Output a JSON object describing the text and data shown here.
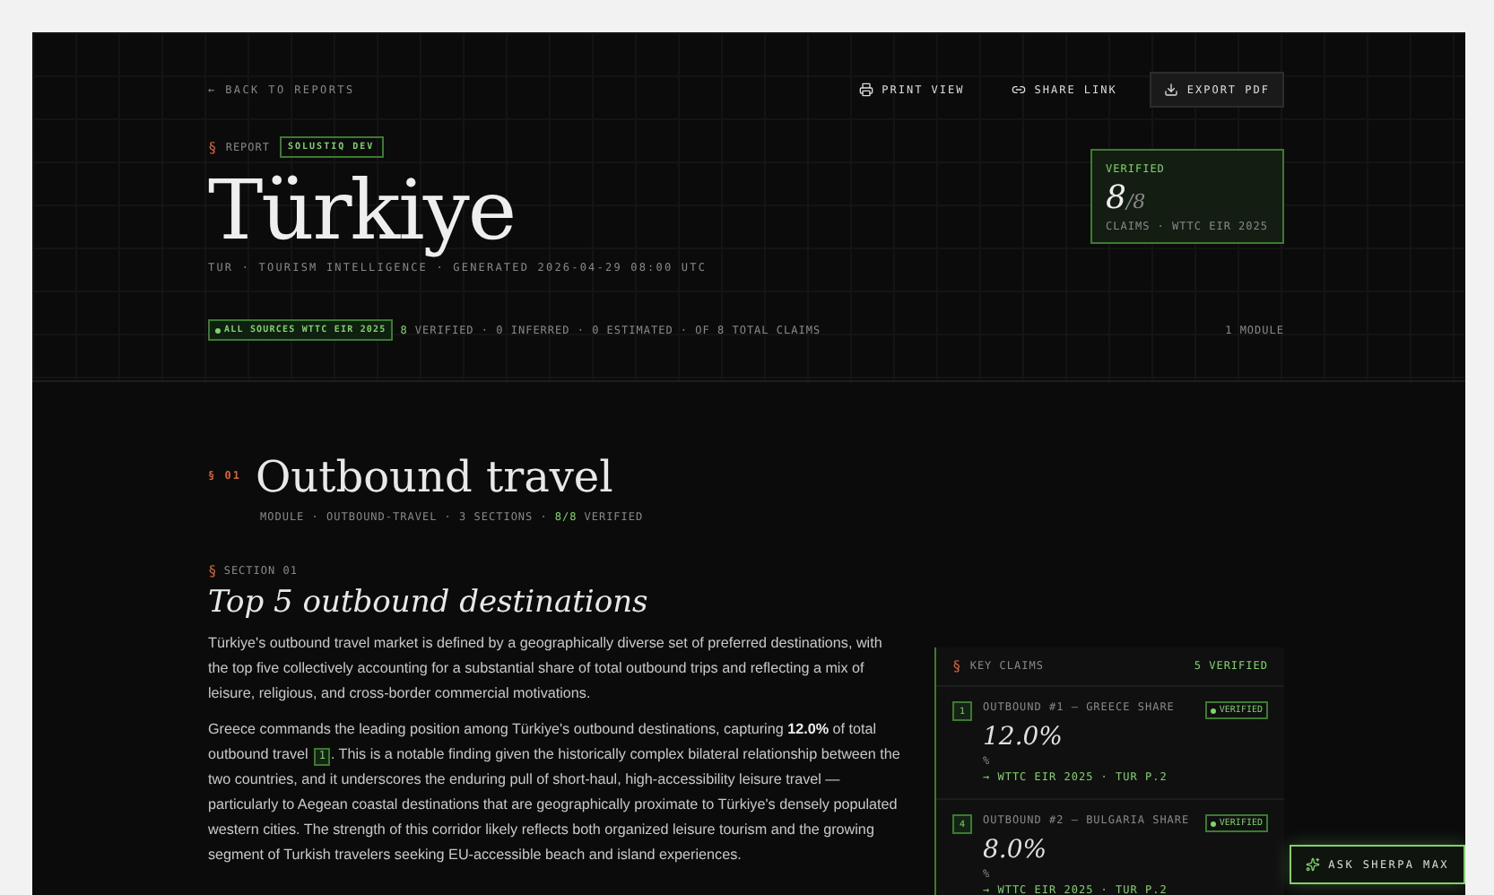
{
  "nav": {
    "back": "← BACK TO REPORTS",
    "actions": [
      {
        "kind": "print",
        "label": "PRINT VIEW",
        "boxed": false
      },
      {
        "kind": "share",
        "label": "SHARE LINK",
        "boxed": false
      },
      {
        "kind": "export",
        "label": "EXPORT PDF",
        "boxed": true
      }
    ]
  },
  "report": {
    "mark": "§",
    "label": "REPORT",
    "tag": "SOLUSTIQ DEV",
    "title": "Türkiye",
    "subtitle": "TUR · TOURISM INTELLIGENCE · GENERATED 2026-04-29 08:00 UTC"
  },
  "verified_card": {
    "label": "VERIFIED",
    "count": "8",
    "total": "/8",
    "caption": "CLAIMS · WTTC EIR 2025"
  },
  "summary": {
    "sources": "ALL SOURCES WTTC EIR 2025",
    "verified_count": "8",
    "rest": "VERIFIED · 0 INFERRED · 0 ESTIMATED · OF 8 TOTAL CLAIMS",
    "modules": "1 MODULE"
  },
  "module": {
    "number": "§ 01",
    "title": "Outbound travel",
    "meta": "MODULE · OUTBOUND-TRAVEL · 3 SECTIONS ·",
    "meta_verified": "8/8",
    "meta_end": "VERIFIED"
  },
  "section": {
    "mark": "§",
    "label": "SECTION 01",
    "title": "Top 5 outbound destinations",
    "paragraphs": [
      {
        "before": "Türkiye's outbound travel market is defined by a geographically diverse set of preferred destinations, with the top five collectively accounting for a substantial share of total outbound trips and reflecting a mix of leisure, religious, and cross-border commercial motivations."
      },
      {
        "before": "Greece commands the leading position among Türkiye's outbound destinations, capturing **12.0%** of total outbound travel",
        "footnote": "1",
        "after": ". This is a notable finding given the historically complex bilateral relationship between the two countries, and it underscores the enduring pull of short-haul, high-accessibility leisure travel — particularly to Aegean coastal destinations that are geographically proximate to Türkiye's densely populated western cities. The strength of this corridor likely reflects both organized leisure tourism and the growing segment of Turkish travelers seeking EU-accessible beach and island experiences."
      }
    ]
  },
  "key_claims": {
    "mark": "§",
    "title": "KEY CLAIMS",
    "count": "5 VERIFIED",
    "claims": [
      {
        "number": "1",
        "label": "OUTBOUND #1 — GREECE SHARE",
        "verified": true,
        "badge": "VERIFIED",
        "value": "12.0%",
        "unit": "%",
        "source": "→ WTTC EIR 2025 · TUR P.2"
      },
      {
        "number": "4",
        "label": "OUTBOUND #2 — BULGARIA SHARE",
        "verified": true,
        "badge": "VERIFIED",
        "value": "8.0%",
        "unit": "%",
        "source": "→ WTTC EIR 2025 · TUR P.2"
      }
    ]
  },
  "assistant_button": {
    "label": "ASK SHERPA MAX"
  }
}
